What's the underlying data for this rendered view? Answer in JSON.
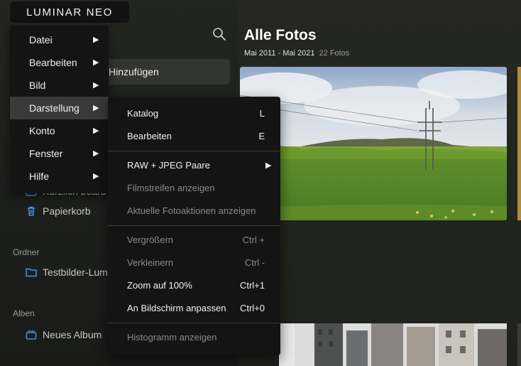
{
  "app": {
    "logo": "LUMINAR NEO"
  },
  "sidebar": {
    "add_button": "Hinzufügen",
    "rows": [
      {
        "label": "Kürzlich bearb",
        "icon": "recent-icon"
      },
      {
        "label": "Papierkorb",
        "icon": "trash-icon"
      }
    ],
    "folders_title": "Ordner",
    "folder_item": "Testbilder-Lum",
    "albums_title": "Alben",
    "album_item": "Neues Album"
  },
  "main": {
    "title": "Alle Fotos",
    "date_range": "Mai 2011 - Mai 2021",
    "count": "22 Fotos"
  },
  "menu": {
    "items": [
      {
        "label": "Datei",
        "arrow": "▶"
      },
      {
        "label": "Bearbeiten",
        "arrow": "▶"
      },
      {
        "label": "Bild",
        "arrow": "▶"
      },
      {
        "label": "Darstellung",
        "arrow": "▶"
      },
      {
        "label": "Konto",
        "arrow": "▶"
      },
      {
        "label": "Fenster",
        "arrow": "▶"
      },
      {
        "label": "Hilfe",
        "arrow": "▶"
      }
    ],
    "active": "Darstellung"
  },
  "submenu": {
    "items": [
      {
        "label": "Katalog",
        "shortcut": "L",
        "enabled": true
      },
      {
        "label": "Bearbeiten",
        "shortcut": "E",
        "enabled": true
      },
      {
        "label": "RAW + JPEG Paare",
        "arrow": "▶",
        "enabled": true
      },
      {
        "label": "Filmstreifen anzeigen",
        "enabled": false
      },
      {
        "label": "Aktuelle Fotoaktionen anzeigen",
        "enabled": false
      },
      {
        "label": "Vergrößern",
        "shortcut": "Ctrl +",
        "enabled": false
      },
      {
        "label": "Verkleinern",
        "shortcut": "Ctrl -",
        "enabled": false
      },
      {
        "label": "Zoom auf 100%",
        "shortcut": "Ctrl+1",
        "enabled": true
      },
      {
        "label": "An Bildschirm anpassen",
        "shortcut": "Ctrl+0",
        "enabled": true
      },
      {
        "label": "Histogramm anzeigen",
        "enabled": false
      }
    ]
  },
  "colors": {
    "accent_icon": "#4a8fe0",
    "menu_bg": "#141414",
    "active_item": "#3a3a3a"
  }
}
